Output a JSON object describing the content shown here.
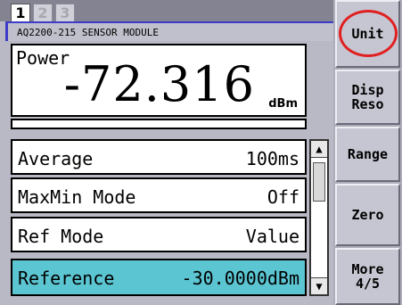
{
  "tabs": [
    {
      "label": "1",
      "active": true
    },
    {
      "label": "2",
      "active": false
    },
    {
      "label": "3",
      "active": false
    }
  ],
  "module": {
    "title": "AQ2200-215 SENSOR MODULE"
  },
  "measurement": {
    "label": "Power",
    "value": "-72.316",
    "unit": "dBm"
  },
  "settings": [
    {
      "label": "Average",
      "value": "100ms"
    },
    {
      "label": "MaxMin Mode",
      "value": "Off"
    },
    {
      "label": "Ref Mode",
      "value": "Value"
    },
    {
      "label": "Reference",
      "value": "-30.0000dBm",
      "selected": true
    }
  ],
  "softkeys": [
    {
      "label": "Unit"
    },
    {
      "label": "Disp\nReso"
    },
    {
      "label": "Range"
    },
    {
      "label": "Zero"
    },
    {
      "label": "More\n4/5"
    }
  ],
  "colors": {
    "selected_row": "#5bc5d2",
    "highlight_circle": "#e02020",
    "module_accent": "#3c3cc8"
  }
}
